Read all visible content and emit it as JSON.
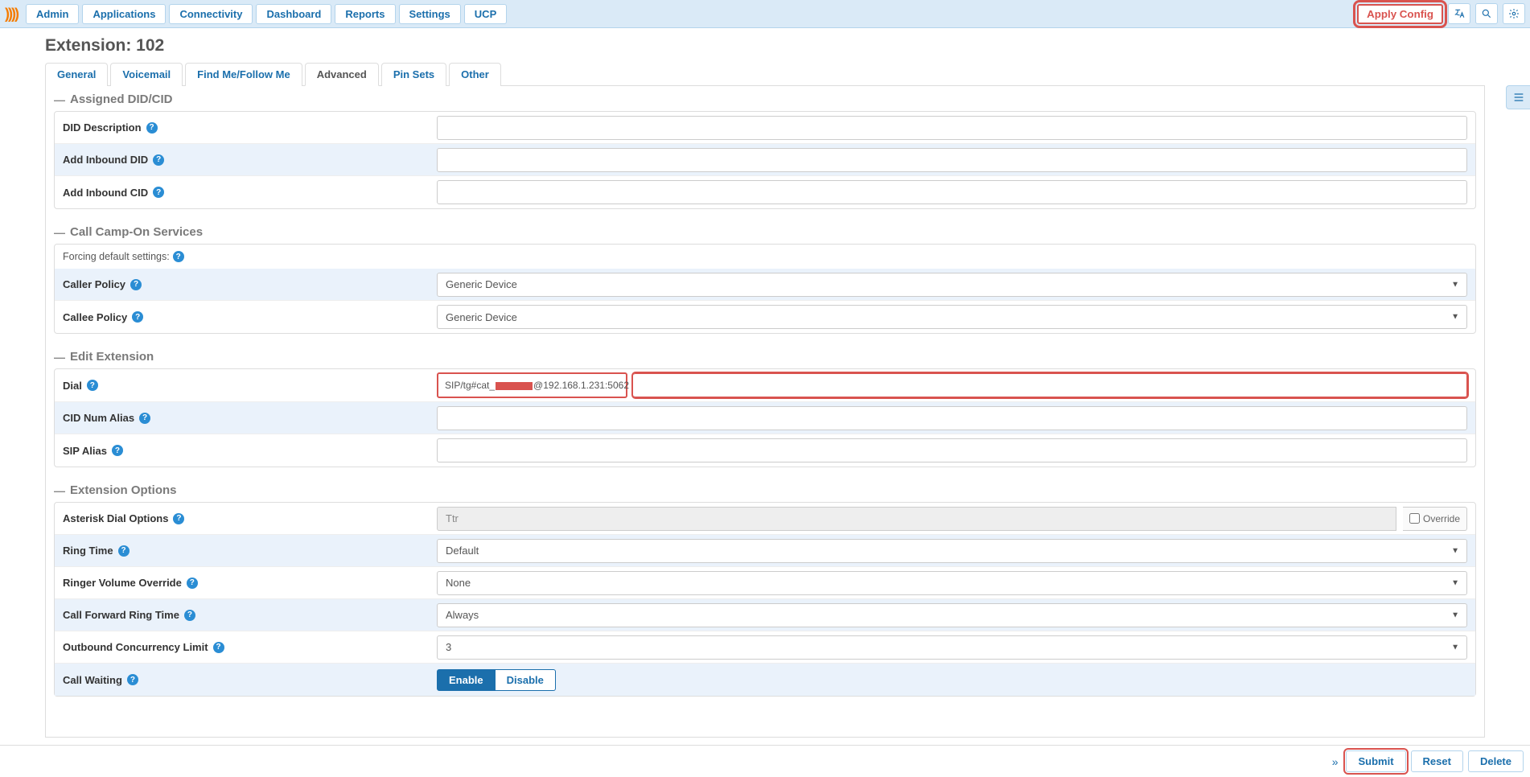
{
  "nav": {
    "items": [
      "Admin",
      "Applications",
      "Connectivity",
      "Dashboard",
      "Reports",
      "Settings",
      "UCP"
    ],
    "apply_config": "Apply Config"
  },
  "page": {
    "title": "Extension: 102"
  },
  "tabs": {
    "items": [
      "General",
      "Voicemail",
      "Find Me/Follow Me",
      "Advanced",
      "Pin Sets",
      "Other"
    ],
    "active_index": 3
  },
  "sections": {
    "assigned": {
      "title": "Assigned DID/CID",
      "did_description_label": "DID Description",
      "add_inbound_did_label": "Add Inbound DID",
      "add_inbound_cid_label": "Add Inbound CID",
      "did_description_value": "",
      "add_inbound_did_value": "",
      "add_inbound_cid_value": ""
    },
    "campon": {
      "title": "Call Camp-On Services",
      "forcing_note": "Forcing default settings:",
      "caller_policy_label": "Caller Policy",
      "callee_policy_label": "Callee Policy",
      "caller_policy_value": "Generic Device",
      "callee_policy_value": "Generic Device"
    },
    "edit_ext": {
      "title": "Edit Extension",
      "dial_label": "Dial",
      "dial_value_prefix": "SIP/tg#cat_",
      "dial_value_suffix": "@192.168.1.231:5062",
      "cid_num_alias_label": "CID Num Alias",
      "cid_num_alias_value": "",
      "sip_alias_label": "SIP Alias",
      "sip_alias_value": ""
    },
    "ext_opts": {
      "title": "Extension Options",
      "asterisk_dial_label": "Asterisk Dial Options",
      "asterisk_dial_value": "Ttr",
      "override_label": "Override",
      "ring_time_label": "Ring Time",
      "ring_time_value": "Default",
      "ringer_volume_label": "Ringer Volume Override",
      "ringer_volume_value": "None",
      "cfwd_ring_time_label": "Call Forward Ring Time",
      "cfwd_ring_time_value": "Always",
      "outbound_concurrency_label": "Outbound Concurrency Limit",
      "outbound_concurrency_value": "3",
      "call_waiting_label": "Call Waiting",
      "enable_label": "Enable",
      "disable_label": "Disable"
    }
  },
  "footer": {
    "submit": "Submit",
    "reset": "Reset",
    "delete": "Delete"
  }
}
